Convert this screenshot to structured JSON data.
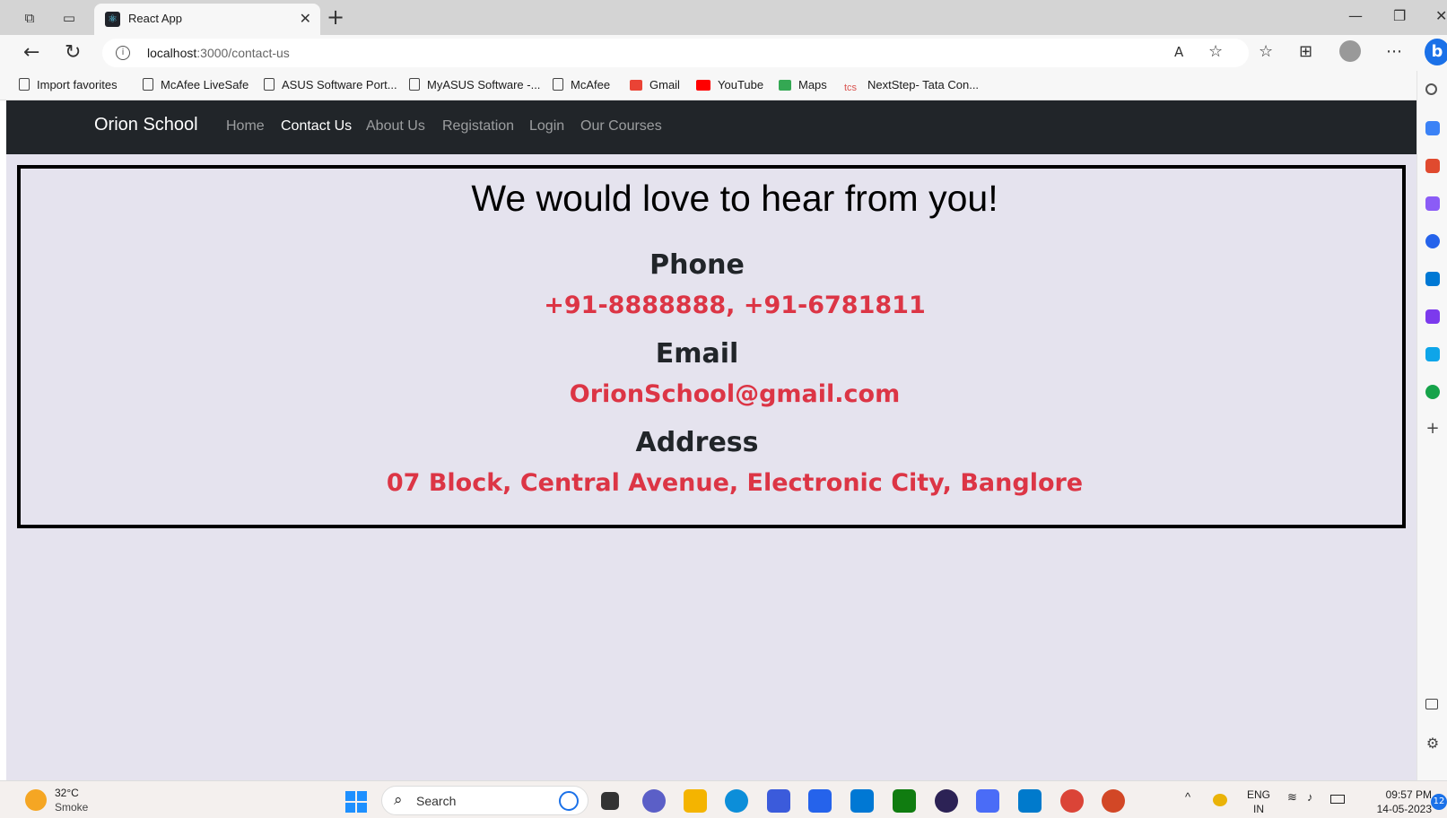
{
  "browser": {
    "tab_title": "React App",
    "url_host": "localhost",
    "url_path": ":3000/contact-us",
    "bookmarks": [
      "Import favorites",
      "McAfee LiveSafe",
      "ASUS Software Port...",
      "MyASUS Software -...",
      "McAfee",
      "Gmail",
      "YouTube",
      "Maps",
      "NextStep- Tata Con..."
    ]
  },
  "app": {
    "brand": "Orion School",
    "nav": [
      "Home",
      "Contact Us",
      "About Us",
      "Registation",
      "Login",
      "Our Courses"
    ],
    "active_nav": "Contact Us",
    "heading": "We would love to hear from you!",
    "phone_label": "Phone",
    "phone_value": "+91-8888888, +91-6781811",
    "email_label": "Email",
    "email_value": "OrionSchool@gmail.com",
    "address_label": "Address",
    "address_value": "07 Block, Central Avenue, Electronic City, Banglore"
  },
  "taskbar": {
    "temperature": "32°C",
    "condition": "Smoke",
    "search_placeholder": "Search",
    "lang_top": "ENG",
    "lang_bottom": "IN",
    "time": "09:57 PM",
    "date": "14-05-2023",
    "notification_count": "12"
  },
  "colors": {
    "navbar": "#212529",
    "page_bg": "#e5e3ee",
    "value_red": "#dc3545",
    "label_dark": "#212529"
  }
}
